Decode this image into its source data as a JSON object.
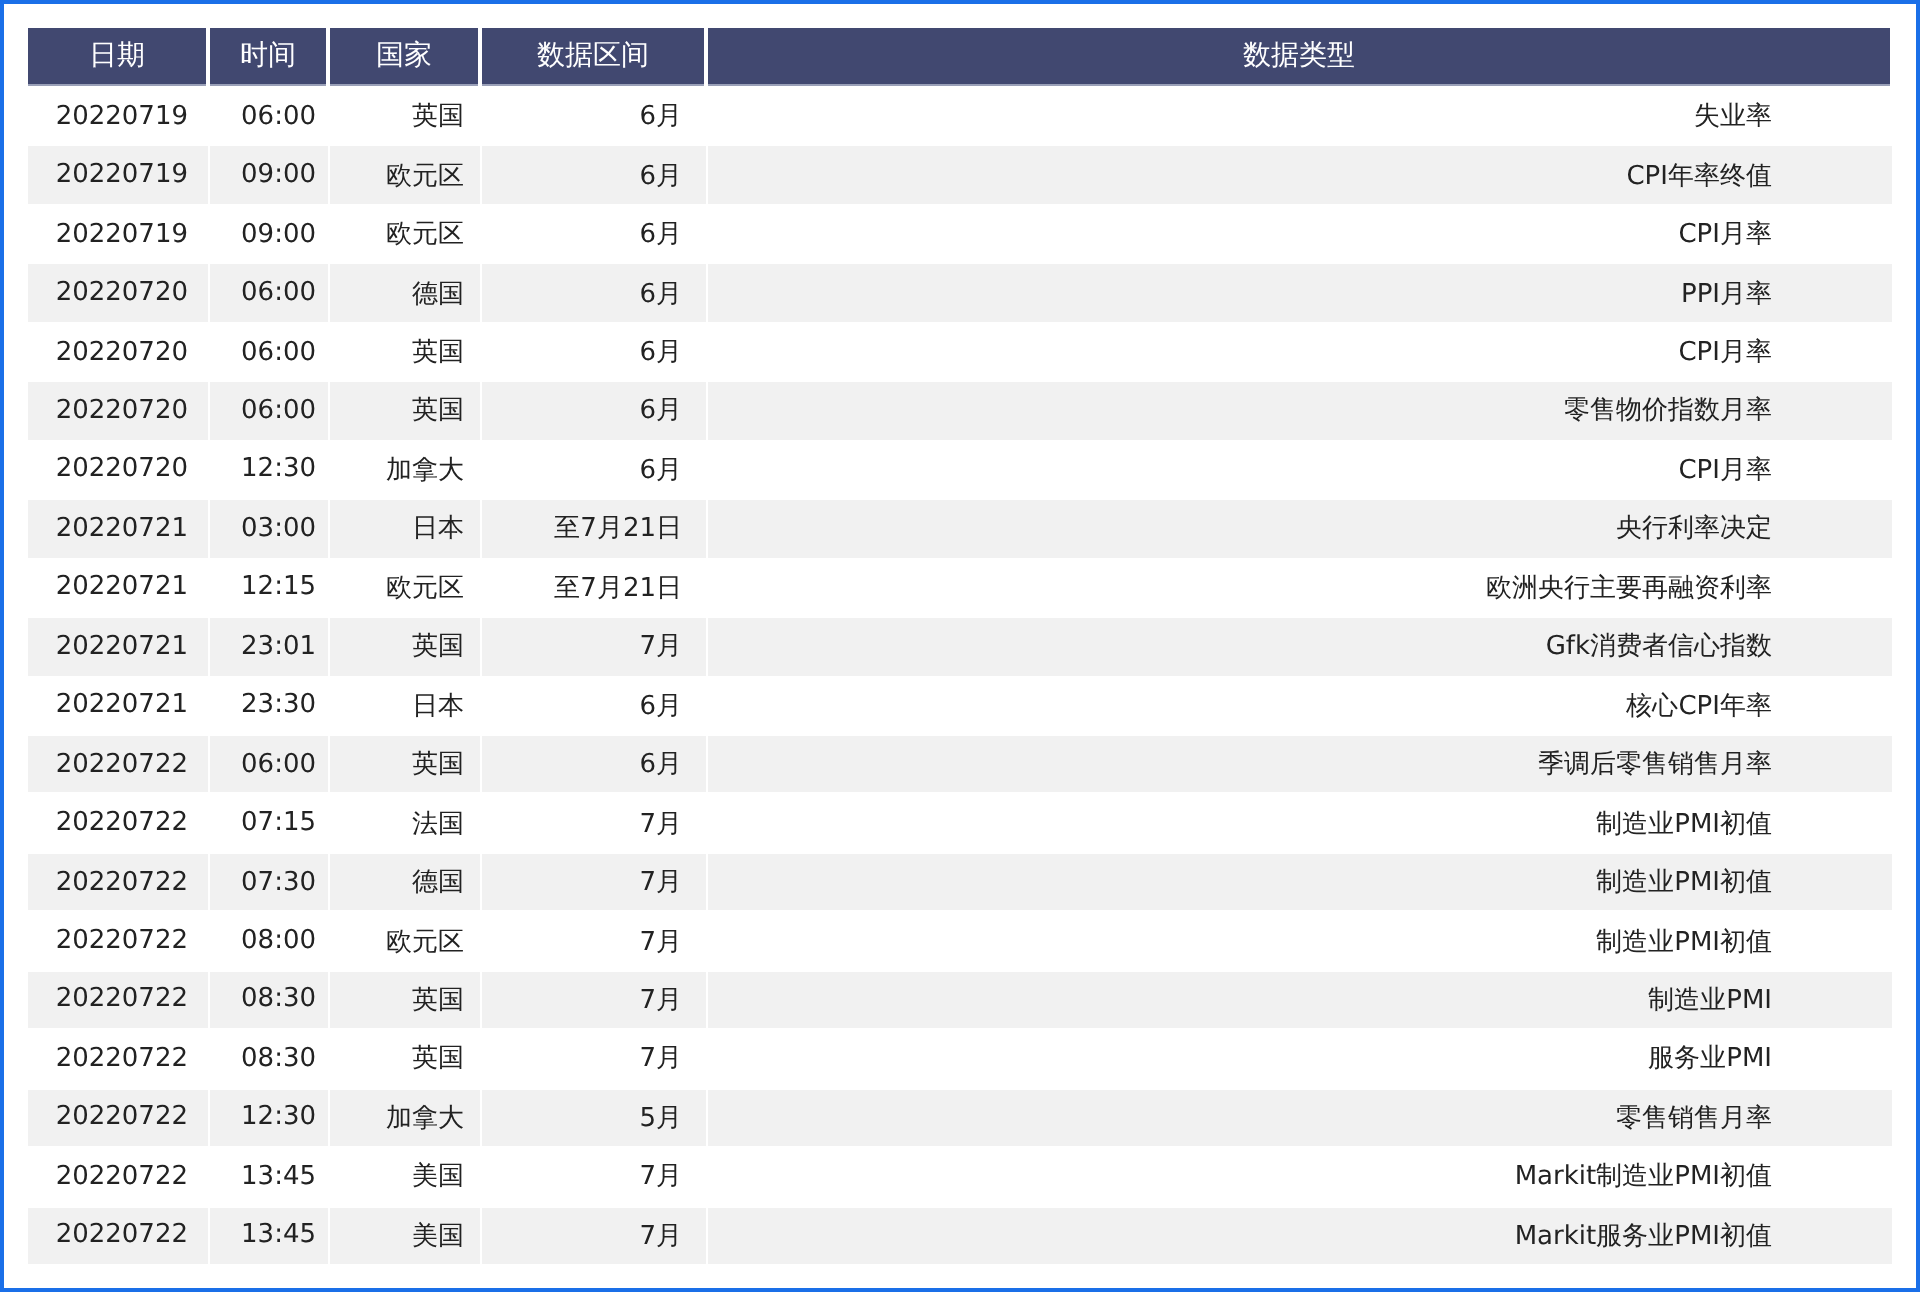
{
  "table": {
    "columns": [
      "日期",
      "时间",
      "国家",
      "数据区间",
      "数据类型"
    ],
    "rows": [
      [
        "20220719",
        "06:00",
        "英国",
        "6月",
        "失业率"
      ],
      [
        "20220719",
        "09:00",
        "欧元区",
        "6月",
        "CPI年率终值"
      ],
      [
        "20220719",
        "09:00",
        "欧元区",
        "6月",
        "CPI月率"
      ],
      [
        "20220720",
        "06:00",
        "德国",
        "6月",
        "PPI月率"
      ],
      [
        "20220720",
        "06:00",
        "英国",
        "6月",
        "CPI月率"
      ],
      [
        "20220720",
        "06:00",
        "英国",
        "6月",
        "零售物价指数月率"
      ],
      [
        "20220720",
        "12:30",
        "加拿大",
        "6月",
        "CPI月率"
      ],
      [
        "20220721",
        "03:00",
        "日本",
        "至7月21日",
        "央行利率决定"
      ],
      [
        "20220721",
        "12:15",
        "欧元区",
        "至7月21日",
        "欧洲央行主要再融资利率"
      ],
      [
        "20220721",
        "23:01",
        "英国",
        "7月",
        "Gfk消费者信心指数"
      ],
      [
        "20220721",
        "23:30",
        "日本",
        "6月",
        "核心CPI年率"
      ],
      [
        "20220722",
        "06:00",
        "英国",
        "6月",
        "季调后零售销售月率"
      ],
      [
        "20220722",
        "07:15",
        "法国",
        "7月",
        "制造业PMI初值"
      ],
      [
        "20220722",
        "07:30",
        "德国",
        "7月",
        "制造业PMI初值"
      ],
      [
        "20220722",
        "08:00",
        "欧元区",
        "7月",
        "制造业PMI初值"
      ],
      [
        "20220722",
        "08:30",
        "英国",
        "7月",
        "制造业PMI"
      ],
      [
        "20220722",
        "08:30",
        "英国",
        "7月",
        "服务业PMI"
      ],
      [
        "20220722",
        "12:30",
        "加拿大",
        "5月",
        "零售销售月率"
      ],
      [
        "20220722",
        "13:45",
        "美国",
        "7月",
        "Markit制造业PMI初值"
      ],
      [
        "20220722",
        "13:45",
        "美国",
        "7月",
        "Markit服务业PMI初值"
      ]
    ]
  }
}
